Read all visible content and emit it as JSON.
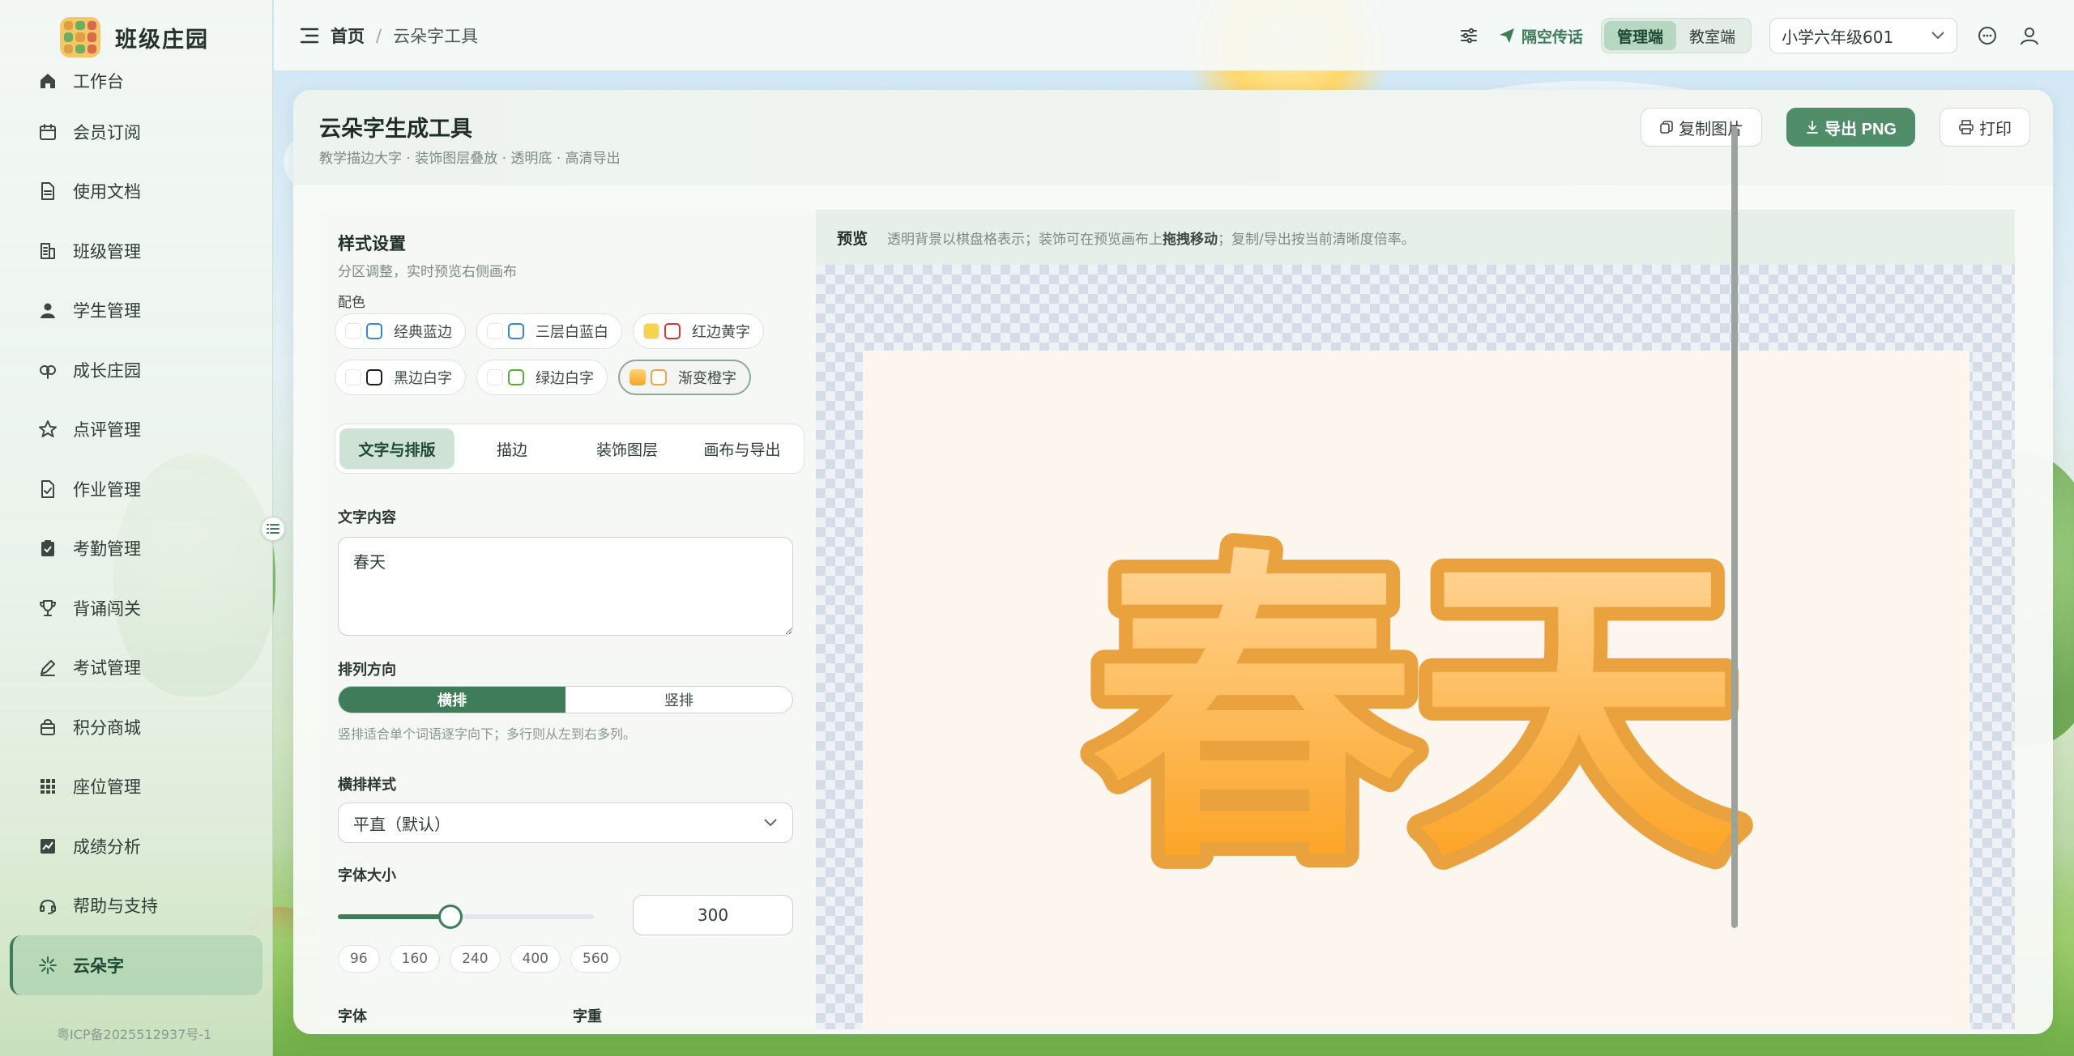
{
  "brand": {
    "name": "班级庄园"
  },
  "sidebar": {
    "items": [
      {
        "label": "工作台",
        "icon": "home-icon"
      },
      {
        "label": "会员订阅",
        "icon": "calendar-icon"
      },
      {
        "label": "使用文档",
        "icon": "document-icon"
      },
      {
        "label": "班级管理",
        "icon": "building-icon"
      },
      {
        "label": "学生管理",
        "icon": "user-icon"
      },
      {
        "label": "成长庄园",
        "icon": "seedling-icon"
      },
      {
        "label": "点评管理",
        "icon": "star-icon"
      },
      {
        "label": "作业管理",
        "icon": "homework-icon"
      },
      {
        "label": "考勤管理",
        "icon": "clipboard-check-icon"
      },
      {
        "label": "背诵闯关",
        "icon": "trophy-icon"
      },
      {
        "label": "考试管理",
        "icon": "pen-icon"
      },
      {
        "label": "积分商城",
        "icon": "shop-icon"
      },
      {
        "label": "座位管理",
        "icon": "grid-icon"
      },
      {
        "label": "成绩分析",
        "icon": "chart-icon"
      },
      {
        "label": "帮助与支持",
        "icon": "headset-icon"
      },
      {
        "label": "云朵字",
        "icon": "sparkle-icon",
        "active": true
      }
    ],
    "icp": "粤ICP备2025512937号-1"
  },
  "header": {
    "breadcrumb_home": "首页",
    "breadcrumb_sep": "/",
    "breadcrumb_current": "云朵字工具",
    "broadcast_label": "隔空传话",
    "mode_admin": "管理端",
    "mode_classroom": "教室端",
    "class_selected": "小学六年级601"
  },
  "tool": {
    "title": "云朵字生成工具",
    "subtitle": "教学描边大字 · 装饰图层叠放 · 透明底 · 高清导出",
    "copy_label": "复制图片",
    "export_label": "导出 PNG",
    "print_label": "打印"
  },
  "settings": {
    "title": "样式设置",
    "subtitle": "分区调整，实时预览右侧画布",
    "palette_label": "配色",
    "palettes": [
      {
        "label": "经典蓝边",
        "fill": "#ffffff",
        "stroke": "#3a86d6"
      },
      {
        "label": "三层白蓝白",
        "fill": "#ffffff",
        "stroke": "#3a86d6"
      },
      {
        "label": "红边黄字",
        "fill": "#f7d34a",
        "stroke": "#d8333a"
      },
      {
        "label": "黑边白字",
        "fill": "#ffffff",
        "stroke": "#1e1e1e"
      },
      {
        "label": "绿边白字",
        "fill": "#ffffff",
        "stroke": "#5aaa3c"
      },
      {
        "label": "渐变橙字",
        "fill": "#f5a623",
        "stroke": "#f0a34a",
        "selected": true
      }
    ],
    "tabs": [
      {
        "label": "文字与排版",
        "active": true
      },
      {
        "label": "描边"
      },
      {
        "label": "装饰图层"
      },
      {
        "label": "画布与导出"
      }
    ],
    "text_label": "文字内容",
    "text_value": "春天",
    "direction_label": "排列方向",
    "direction_horizontal": "横排",
    "direction_vertical": "竖排",
    "direction_hint": "竖排适合单个词语逐字向下；多行则从左到右多列。",
    "h_style_label": "横排样式",
    "h_style_value": "平直（默认）",
    "font_size_label": "字体大小",
    "font_size_value": "300",
    "font_size_min": 96,
    "font_size_max": 560,
    "font_size_presets": [
      "96",
      "160",
      "240",
      "400",
      "560"
    ],
    "font_label": "字体",
    "weight_label": "字重"
  },
  "preview": {
    "title": "预览",
    "hint_prefix": "透明背景以棋盘格表示；装饰可在预览画布上",
    "hint_bold": "拖拽移动",
    "hint_suffix": "；复制/导出按当前清晰度倍率。",
    "canvas_text": "春天",
    "text_gradient": [
      "#ffd9a0",
      "#fb9e16"
    ],
    "stroke_color": "#e9a23d",
    "canvas_bg": "#fdf6ee"
  },
  "colors": {
    "accent": "#3f7d5a",
    "primary_button": "#4f8e68"
  }
}
